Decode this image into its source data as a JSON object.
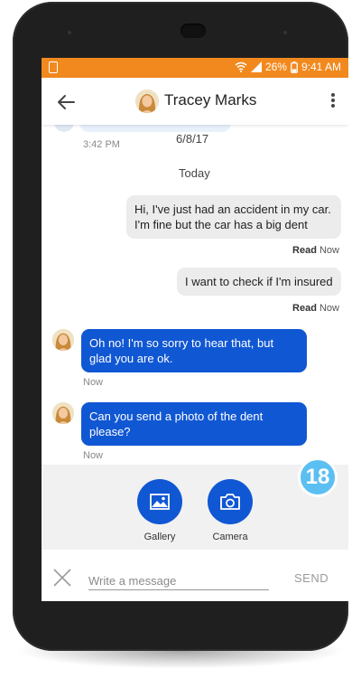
{
  "status_bar": {
    "battery": "26%",
    "time": "9:41 AM"
  },
  "header": {
    "contact_name": "Tracey Marks"
  },
  "chat": {
    "prev_time": "3:42 PM",
    "prev_date": "6/8/17",
    "day_separator": "Today",
    "messages": [
      {
        "direction": "outgoing",
        "text": "Hi, I've just had an accident in my car. I'm fine but the car has a big dent",
        "receipt_status": "Read",
        "receipt_time": "Now"
      },
      {
        "direction": "outgoing",
        "text": "I want to check if I'm insured",
        "receipt_status": "Read",
        "receipt_time": "Now"
      },
      {
        "direction": "incoming",
        "text": "Oh no! I'm so sorry to hear that, but glad you are ok.",
        "time": "Now"
      },
      {
        "direction": "incoming",
        "text": "Can you send a photo of the dent please?",
        "time": "Now"
      }
    ]
  },
  "attachments": {
    "gallery_label": "Gallery",
    "camera_label": "Camera"
  },
  "badge": {
    "count": "18"
  },
  "composer": {
    "placeholder": "Write a message",
    "send_label": "SEND"
  },
  "colors": {
    "status_bar": "#f2891e",
    "incoming_bubble": "#1057d3",
    "outgoing_bubble": "#ececec",
    "badge": "#5bbff2"
  }
}
